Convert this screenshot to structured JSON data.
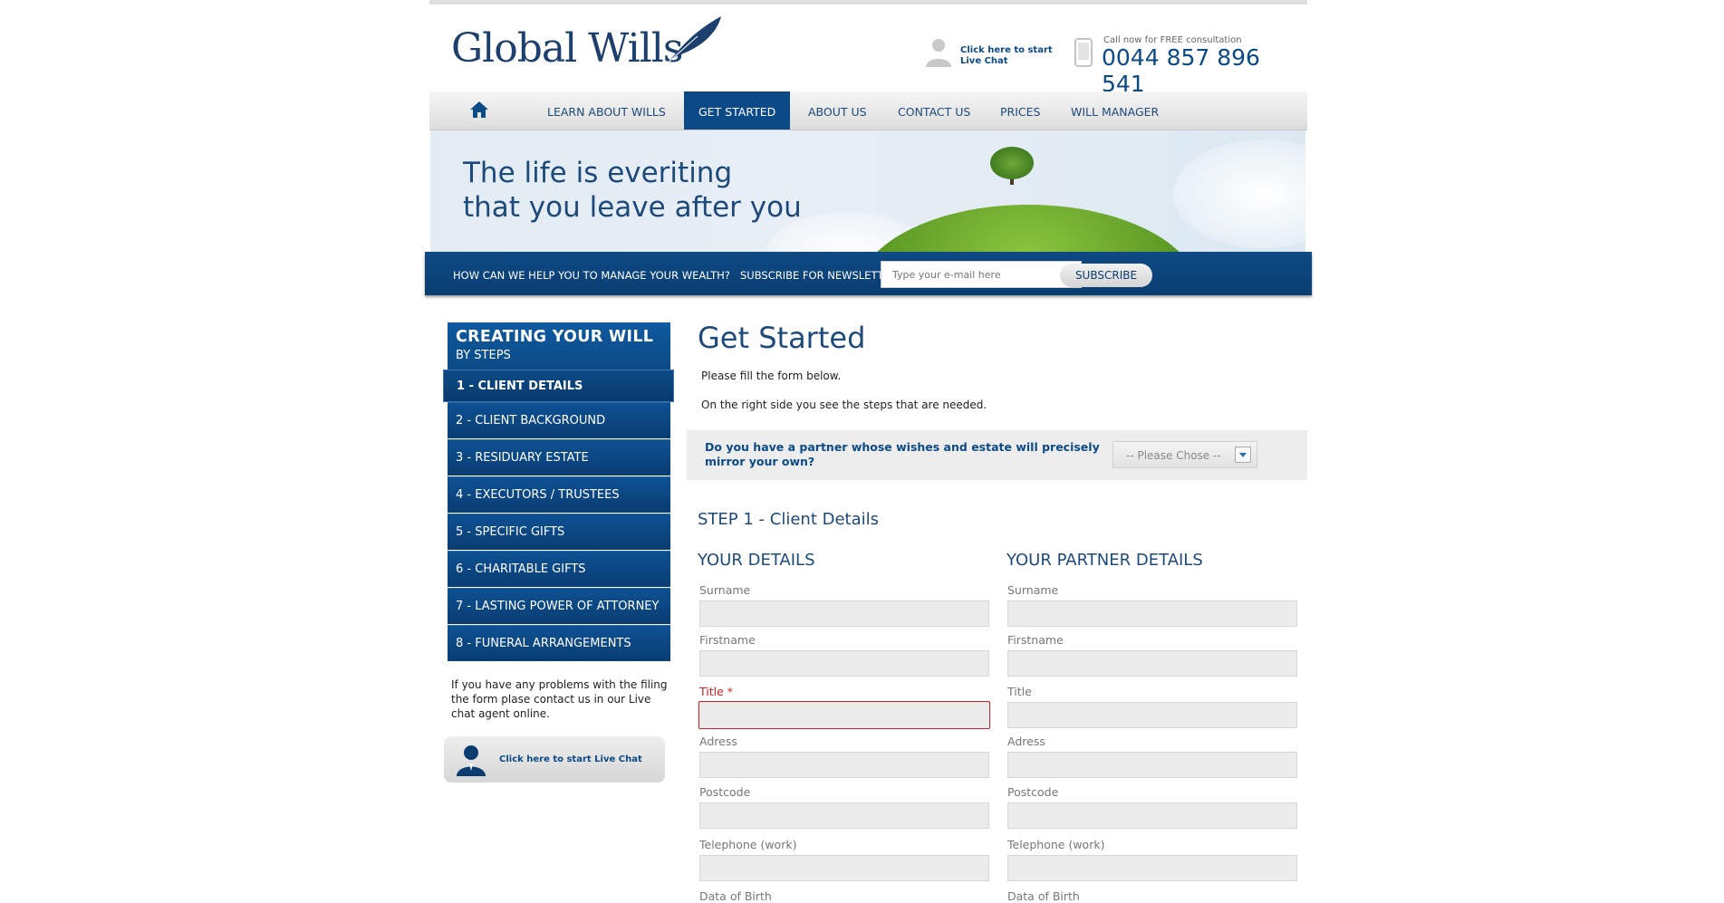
{
  "header": {
    "logo_text": "Global Wills",
    "chat_line1": "Click here to start",
    "chat_line2": "Live Chat",
    "call_text": "Call now for FREE consultation",
    "phone": "0044 857 896 541"
  },
  "nav": {
    "home_icon": "home-icon",
    "items": [
      "LEARN ABOUT WILLS",
      "GET STARTED",
      "ABOUT US",
      "CONTACT US",
      "PRICES",
      "WILL MANAGER"
    ],
    "active": "GET STARTED"
  },
  "banner": {
    "line1": "The life is everiting",
    "line2": "that you leave after you"
  },
  "newsletter": {
    "question": "HOW CAN WE HELP YOU TO MANAGE YOUR WEALTH?",
    "label": "SUBSCRIBE FOR NEWSLETTER",
    "placeholder": "Type your e-mail here",
    "button": "SUBSCRIBE"
  },
  "sidebar": {
    "title": "CREATING YOUR WILL",
    "subtitle": "BY STEPS",
    "steps": [
      "1 -  CLIENT DETAILS",
      "2 - CLIENT BACKGROUND",
      "3 - RESIDUARY ESTATE",
      "4 - EXECUTORS / TRUSTEES",
      "5 - SPECIFIC GIFTS",
      "6 - CHARITABLE GIFTS",
      "7 - LASTING POWER OF ATTORNEY",
      "8 - FUNERAL ARRANGEMENTS"
    ],
    "note": "If you have any problems with the filing the form plase contact us in our Live chat agent online.",
    "chat_button": "Click here to start Live Chat"
  },
  "main": {
    "title": "Get Started",
    "intro1": "Please fill the form below.",
    "intro2": "On the right side you see the steps that are needed.",
    "partner_question": "Do you have a partner whose wishes and estate will precisely mirror your own?",
    "partner_select": "-- Please Chose --",
    "step_heading": "STEP 1 - Client Details",
    "your_details": "YOUR DETAILS",
    "partner_details": "YOUR PARTNER DETAILS",
    "fields": [
      "Surname",
      "Firstname",
      "Title",
      "Adress",
      "Postcode",
      "Telephone (work)",
      "Data of Birth"
    ],
    "required_marker": "*",
    "colors": {
      "accent": "#0b4a86",
      "error": "#d21f1f"
    }
  }
}
